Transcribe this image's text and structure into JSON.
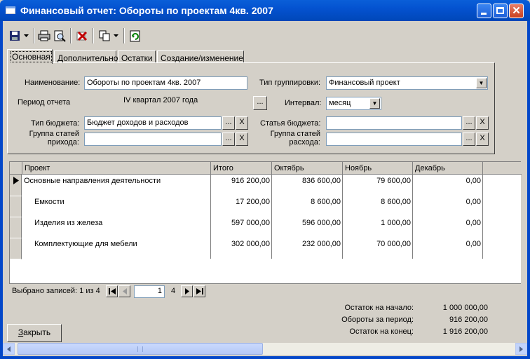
{
  "window": {
    "title": "Финансовый отчет: Обороты по проектам 4кв. 2007",
    "close_glyph": "✕"
  },
  "toolbar": {
    "icons": [
      "save-icon",
      "dropdown-arrow",
      "print-icon",
      "print-preview-icon",
      "delete-icon",
      "copy-icon",
      "dropdown-arrow",
      "refresh-icon"
    ]
  },
  "tabs": [
    {
      "label": "Основная",
      "active": true
    },
    {
      "label": "Дополнительно",
      "active": false
    },
    {
      "label": "Остатки",
      "active": false
    },
    {
      "label": "Создание/изменение",
      "active": false
    }
  ],
  "form": {
    "name_label": "Наименование:",
    "name_value": "Обороты по проектам 4кв. 2007",
    "period_label": "Период отчета",
    "period_value": "IV квартал 2007 года",
    "period_button": "...",
    "grouping_label": "Тип группировки:",
    "grouping_value": "Финансовый проект",
    "interval_label": "Интервал:",
    "interval_value": "месяц",
    "budget_type_label": "Тип бюджета:",
    "budget_type_value": "Бюджет доходов и расходов",
    "budget_item_label": "Статья бюджета:",
    "budget_item_value": "",
    "income_group_label_1": "Группа статей",
    "income_group_label_2": "прихода:",
    "income_group_value": "",
    "expense_group_label_1": "Группа статей",
    "expense_group_label_2": "расхода:",
    "expense_group_value": "",
    "ellipsis": "...",
    "clear": "X",
    "arrow": "▼"
  },
  "grid": {
    "columns": [
      "Проект",
      "Итого",
      "Октябрь",
      "Ноябрь",
      "Декабрь"
    ],
    "rows": [
      {
        "project": "Основные направления деятельности",
        "total": "916 200,00",
        "oct": "836 600,00",
        "nov": "79 600,00",
        "dec": "0,00",
        "current": true
      },
      {
        "project": "Емкости",
        "total": "17 200,00",
        "oct": "8 600,00",
        "nov": "8 600,00",
        "dec": "0,00",
        "current": false
      },
      {
        "project": "Изделия из железа",
        "total": "597 000,00",
        "oct": "596 000,00",
        "nov": "1 000,00",
        "dec": "0,00",
        "current": false
      },
      {
        "project": "Комплектующие для мебели",
        "total": "302 000,00",
        "oct": "232 000,00",
        "nov": "70 000,00",
        "dec": "0,00",
        "current": false
      }
    ]
  },
  "navigator": {
    "selected_text": "Выбрано записей: 1 из 4",
    "page_value": "1",
    "page_total": "4"
  },
  "summary": {
    "start_label": "Остаток на начало:",
    "start_value": "1 000 000,00",
    "turnover_label": "Обороты за период:",
    "turnover_value": "916 200,00",
    "end_label": "Остаток на конец:",
    "end_value": "1 916 200,00"
  },
  "buttons": {
    "close_hotkey": "З",
    "close_rest": "акрыть"
  }
}
